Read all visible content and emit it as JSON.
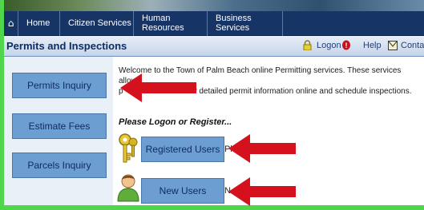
{
  "nav": {
    "items": [
      {
        "label": "Home"
      },
      {
        "label": "Citizen Services"
      },
      {
        "label": "Human Resources"
      },
      {
        "label": "Business Services"
      }
    ]
  },
  "header": {
    "title": "Permits and Inspections",
    "utilities": [
      {
        "label": "Logon",
        "icon": "padlock-icon"
      },
      {
        "label": "Help",
        "icon": "help-icon"
      },
      {
        "label": "Contac",
        "icon": "contact-icon"
      }
    ]
  },
  "sidebar": {
    "items": [
      {
        "label": "Permits Inquiry"
      },
      {
        "label": "Estimate Fees"
      },
      {
        "label": "Parcels Inquiry"
      }
    ]
  },
  "main": {
    "welcome_line1": "Welcome to the Town of Palm Beach online Permitting services. These services allow",
    "welcome_line2_start": "p",
    "welcome_line2_end": "iew detailed permit information online and schedule inspections.",
    "prompt": "Please Logon or Register...",
    "registered_button": "Registered Users",
    "registered_trailing": "Pl",
    "new_users_button": "New Users",
    "new_users_trailing": "N"
  },
  "colors": {
    "frame": "#4fd64a",
    "navbar": "#173466",
    "button": "#6d9ed2",
    "arrow": "#d4111d"
  }
}
